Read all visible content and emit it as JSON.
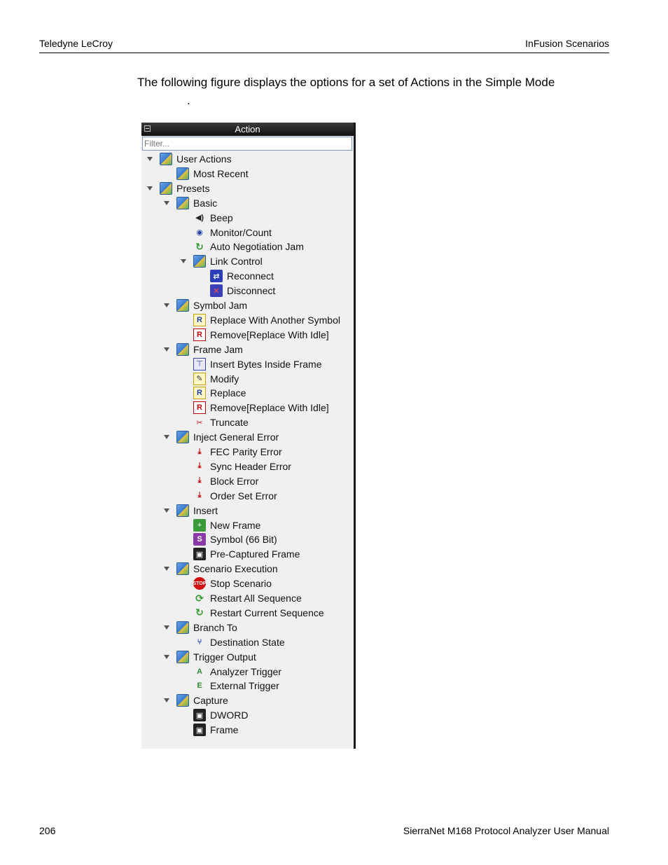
{
  "header": {
    "left": "Teledyne LeCroy",
    "right": "InFusion Scenarios"
  },
  "intro": {
    "text": "The following figure displays the options for a set of Actions in the Simple Mode",
    "dot": "."
  },
  "panel": {
    "title": "Action",
    "filter_placeholder": "Filter...",
    "items": [
      {
        "label": "User Actions",
        "level": 0,
        "expanded": true,
        "icon": "folder-icon"
      },
      {
        "label": "Most Recent",
        "level": 1,
        "expanded": false,
        "icon": "folder-icon"
      },
      {
        "label": "Presets",
        "level": 0,
        "expanded": true,
        "icon": "folder-icon"
      },
      {
        "label": "Basic",
        "level": 1,
        "expanded": true,
        "icon": "folder-icon"
      },
      {
        "label": "Beep",
        "level": 2,
        "icon": "speaker-icon"
      },
      {
        "label": "Monitor/Count",
        "level": 2,
        "icon": "eye-counter-icon"
      },
      {
        "label": "Auto Negotiation Jam",
        "level": 2,
        "icon": "cycle-icon"
      },
      {
        "label": "Link Control",
        "level": 2,
        "expanded": true,
        "icon": "folder-icon"
      },
      {
        "label": "Reconnect",
        "level": 3,
        "icon": "reconnect-icon"
      },
      {
        "label": "Disconnect",
        "level": 3,
        "icon": "disconnect-icon"
      },
      {
        "label": "Symbol Jam",
        "level": 1,
        "expanded": true,
        "icon": "folder-icon"
      },
      {
        "label": "Replace With Another Symbol",
        "level": 2,
        "icon": "replace-icon"
      },
      {
        "label": "Remove[Replace With Idle]",
        "level": 2,
        "icon": "remove-icon"
      },
      {
        "label": "Frame Jam",
        "level": 1,
        "expanded": true,
        "icon": "folder-icon"
      },
      {
        "label": "Insert Bytes Inside Frame",
        "level": 2,
        "icon": "insert-bytes-icon"
      },
      {
        "label": "Modify",
        "level": 2,
        "icon": "modify-icon"
      },
      {
        "label": "Replace",
        "level": 2,
        "icon": "replace-icon"
      },
      {
        "label": "Remove[Replace With Idle]",
        "level": 2,
        "icon": "remove-icon"
      },
      {
        "label": "Truncate",
        "level": 2,
        "icon": "scissors-icon"
      },
      {
        "label": "Inject General Error",
        "level": 1,
        "expanded": true,
        "icon": "folder-icon"
      },
      {
        "label": "FEC Parity Error",
        "level": 2,
        "icon": "error-inject-icon"
      },
      {
        "label": "Sync Header Error",
        "level": 2,
        "icon": "error-inject-icon"
      },
      {
        "label": "Block Error",
        "level": 2,
        "icon": "error-inject-icon"
      },
      {
        "label": "Order Set Error",
        "level": 2,
        "icon": "error-inject-icon"
      },
      {
        "label": "Insert",
        "level": 1,
        "expanded": true,
        "icon": "folder-icon"
      },
      {
        "label": "New Frame",
        "level": 2,
        "icon": "new-frame-icon"
      },
      {
        "label": "Symbol (66 Bit)",
        "level": 2,
        "icon": "symbol-icon"
      },
      {
        "label": "Pre-Captured Frame",
        "level": 2,
        "icon": "camera-icon"
      },
      {
        "label": "Scenario Execution",
        "level": 1,
        "expanded": true,
        "icon": "folder-icon"
      },
      {
        "label": "Stop Scenario",
        "level": 2,
        "icon": "stop-icon"
      },
      {
        "label": "Restart All Sequence",
        "level": 2,
        "icon": "restart-all-icon"
      },
      {
        "label": "Restart Current Sequence",
        "level": 2,
        "icon": "cycle-icon"
      },
      {
        "label": "Branch To",
        "level": 1,
        "expanded": true,
        "icon": "folder-icon"
      },
      {
        "label": "Destination State",
        "level": 2,
        "icon": "branch-icon"
      },
      {
        "label": "Trigger Output",
        "level": 1,
        "expanded": true,
        "icon": "folder-icon"
      },
      {
        "label": "Analyzer Trigger",
        "level": 2,
        "icon": "trigger-a-icon"
      },
      {
        "label": "External Trigger",
        "level": 2,
        "icon": "trigger-e-icon"
      },
      {
        "label": "Capture",
        "level": 1,
        "expanded": true,
        "icon": "folder-icon"
      },
      {
        "label": "DWORD",
        "level": 2,
        "icon": "camera-icon"
      },
      {
        "label": "Frame",
        "level": 2,
        "icon": "camera-icon"
      }
    ]
  },
  "footer": {
    "left": "206",
    "right": "SierraNet M168 Protocol Analyzer User Manual"
  }
}
